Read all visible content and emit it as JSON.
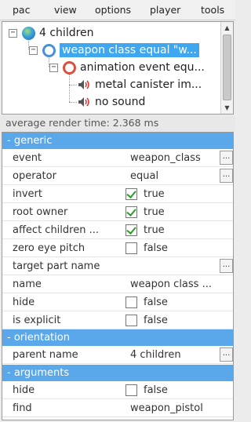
{
  "menu": [
    "pac",
    "view",
    "options",
    "player",
    "tools"
  ],
  "tree": {
    "root": "4 children",
    "selected": "weapon class equal \"w...",
    "child": "animation event equ...",
    "leaf1": "metal canister im...",
    "leaf2": "no sound"
  },
  "render_time": "average render time: 2.368 ms",
  "sections": {
    "generic": "- generic",
    "orientation": "- orientation",
    "arguments": "- arguments"
  },
  "generic": [
    {
      "key": "event",
      "value": "weapon_class",
      "dots": true
    },
    {
      "key": "operator",
      "value": "equal",
      "dots": true
    },
    {
      "key": "invert",
      "checkbox": true,
      "checked": true,
      "value": "true"
    },
    {
      "key": "root owner",
      "checkbox": true,
      "checked": true,
      "value": "true"
    },
    {
      "key": "affect children ...",
      "checkbox": true,
      "checked": true,
      "value": "true"
    },
    {
      "key": "zero eye pitch",
      "checkbox": true,
      "checked": false,
      "value": "false"
    },
    {
      "key": "target part name",
      "value": "",
      "dots": true
    },
    {
      "key": "name",
      "value": "weapon class ..."
    },
    {
      "key": "hide",
      "checkbox": true,
      "checked": false,
      "value": "false"
    },
    {
      "key": "is explicit",
      "checkbox": true,
      "checked": false,
      "value": "false"
    }
  ],
  "orientation": [
    {
      "key": "parent name",
      "value": "4 children",
      "dots": true
    }
  ],
  "arguments": [
    {
      "key": "hide",
      "checkbox": true,
      "checked": false,
      "value": "false"
    },
    {
      "key": "find",
      "value": "weapon_pistol"
    }
  ],
  "dots_label": "...",
  "colors": {
    "section": "#5aa8ea",
    "selection": "#3fa7f0",
    "check": "#2a9d2a"
  }
}
